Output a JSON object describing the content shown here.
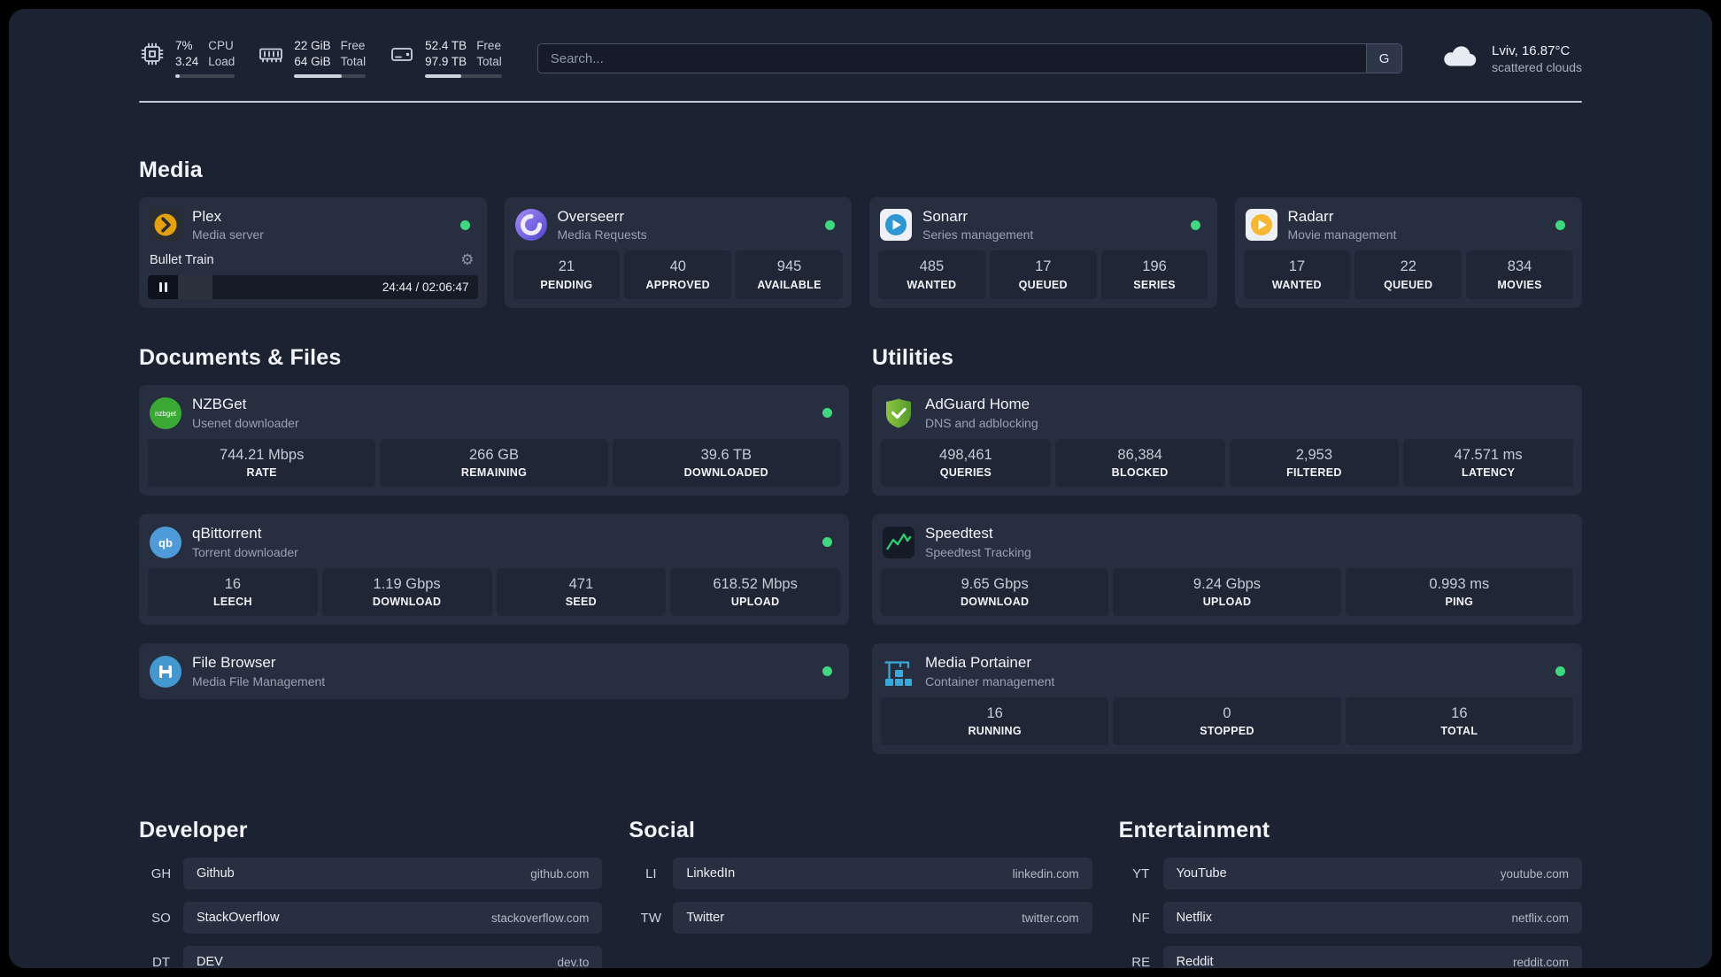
{
  "colors": {
    "status_green": "#3fd77f",
    "background": "#1b2332",
    "card": "#262e3f",
    "tile": "#1f2736"
  },
  "icons": {
    "gear": "⚙",
    "nzbget_text": "nzbget",
    "qb_text": "qb"
  },
  "topbar": {
    "cpu": {
      "value_top": "7%",
      "value_bottom": "3.24",
      "label_top": "CPU",
      "label_bottom": "Load",
      "bar_css": "width:7%"
    },
    "memory": {
      "value_top": "22 GiB",
      "value_bottom": "64 GiB",
      "label_top": "Free",
      "label_bottom": "Total",
      "bar_css": "width:66%"
    },
    "disk": {
      "value_top": "52.4 TB",
      "value_bottom": "97.9 TB",
      "label_top": "Free",
      "label_bottom": "Total",
      "bar_css": "width:47%"
    },
    "search": {
      "placeholder": "Search...",
      "button_label": "G"
    },
    "weather": {
      "location": "Lviv, 16.87°C",
      "condition": "scattered clouds"
    }
  },
  "sections": {
    "media": {
      "title": "Media",
      "plex": {
        "name": "Plex",
        "subtitle": "Media server",
        "player": {
          "title": "Bullet Train",
          "time": "24:44 / 02:06:47",
          "bar_css": "width:19.5%"
        }
      },
      "apps": [
        {
          "name": "Overseerr",
          "subtitle": "Media Requests",
          "stats": [
            {
              "value": "21",
              "label": "PENDING"
            },
            {
              "value": "40",
              "label": "APPROVED"
            },
            {
              "value": "945",
              "label": "AVAILABLE"
            }
          ]
        },
        {
          "name": "Sonarr",
          "subtitle": "Series management",
          "stats": [
            {
              "value": "485",
              "label": "WANTED"
            },
            {
              "value": "17",
              "label": "QUEUED"
            },
            {
              "value": "196",
              "label": "SERIES"
            }
          ]
        },
        {
          "name": "Radarr",
          "subtitle": "Movie management",
          "stats": [
            {
              "value": "17",
              "label": "WANTED"
            },
            {
              "value": "22",
              "label": "QUEUED"
            },
            {
              "value": "834",
              "label": "MOVIES"
            }
          ]
        }
      ]
    },
    "files": {
      "title": "Documents & Files",
      "apps": [
        {
          "name": "NZBGet",
          "subtitle": "Usenet downloader",
          "stats": [
            {
              "value": "744.21 Mbps",
              "label": "RATE"
            },
            {
              "value": "266 GB",
              "label": "REMAINING"
            },
            {
              "value": "39.6 TB",
              "label": "DOWNLOADED"
            }
          ]
        },
        {
          "name": "qBittorrent",
          "subtitle": "Torrent downloader",
          "stats": [
            {
              "value": "16",
              "label": "LEECH"
            },
            {
              "value": "1.19 Gbps",
              "label": "DOWNLOAD"
            },
            {
              "value": "471",
              "label": "SEED"
            },
            {
              "value": "618.52 Mbps",
              "label": "UPLOAD"
            }
          ]
        },
        {
          "name": "File Browser",
          "subtitle": "Media File Management",
          "stats": []
        }
      ]
    },
    "utilities": {
      "title": "Utilities",
      "apps": [
        {
          "name": "AdGuard Home",
          "subtitle": "DNS and adblocking",
          "stats": [
            {
              "value": "498,461",
              "label": "QUERIES"
            },
            {
              "value": "86,384",
              "label": "BLOCKED"
            },
            {
              "value": "2,953",
              "label": "FILTERED"
            },
            {
              "value": "47.571 ms",
              "label": "LATENCY"
            }
          ]
        },
        {
          "name": "Speedtest",
          "subtitle": "Speedtest Tracking",
          "stats": [
            {
              "value": "9.65 Gbps",
              "label": "DOWNLOAD"
            },
            {
              "value": "9.24 Gbps",
              "label": "UPLOAD"
            },
            {
              "value": "0.993 ms",
              "label": "PING"
            }
          ]
        },
        {
          "name": "Media Portainer",
          "subtitle": "Container management",
          "stats": [
            {
              "value": "16",
              "label": "RUNNING"
            },
            {
              "value": "0",
              "label": "STOPPED"
            },
            {
              "value": "16",
              "label": "TOTAL"
            }
          ]
        }
      ]
    }
  },
  "bookmarks": {
    "developer": {
      "title": "Developer",
      "items": [
        {
          "abbr": "GH",
          "name": "Github",
          "domain": "github.com"
        },
        {
          "abbr": "SO",
          "name": "StackOverflow",
          "domain": "stackoverflow.com"
        },
        {
          "abbr": "DT",
          "name": "DEV",
          "domain": "dev.to"
        }
      ]
    },
    "social": {
      "title": "Social",
      "items": [
        {
          "abbr": "LI",
          "name": "LinkedIn",
          "domain": "linkedin.com"
        },
        {
          "abbr": "TW",
          "name": "Twitter",
          "domain": "twitter.com"
        }
      ]
    },
    "entertainment": {
      "title": "Entertainment",
      "items": [
        {
          "abbr": "YT",
          "name": "YouTube",
          "domain": "youtube.com"
        },
        {
          "abbr": "NF",
          "name": "Netflix",
          "domain": "netflix.com"
        },
        {
          "abbr": "RE",
          "name": "Reddit",
          "domain": "reddit.com"
        }
      ]
    }
  }
}
